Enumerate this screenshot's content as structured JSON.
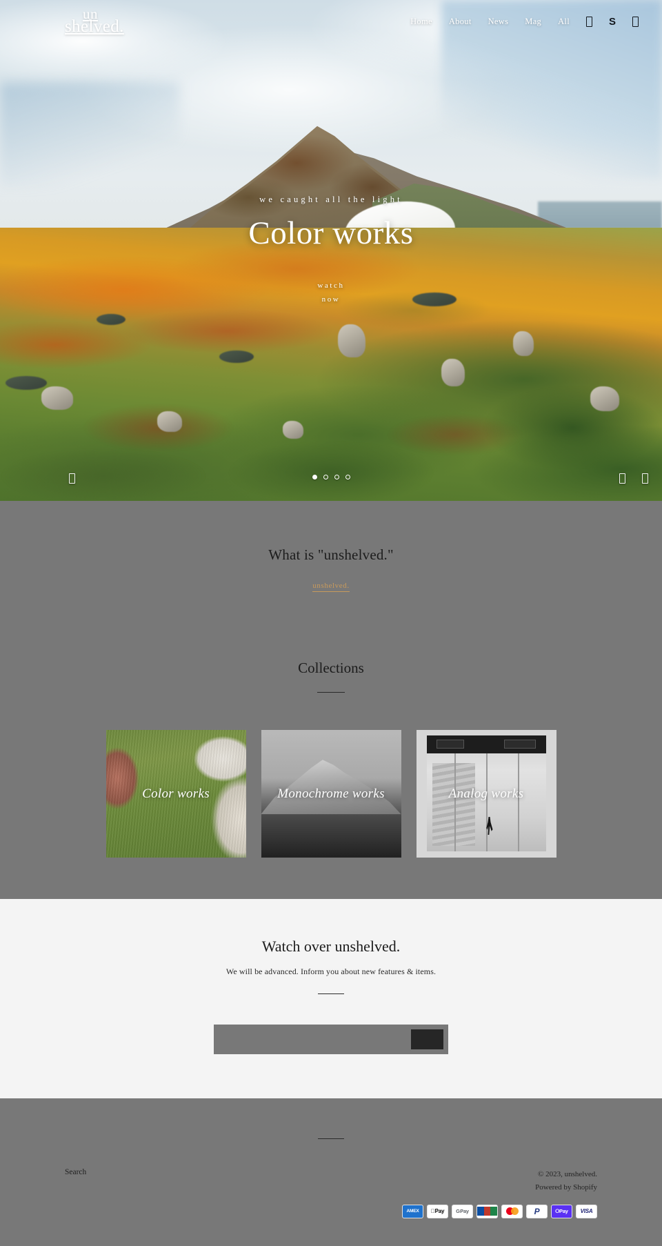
{
  "header": {
    "logo_line1": "un",
    "logo_line2": "shelved.",
    "nav": [
      {
        "label": "Home"
      },
      {
        "label": "About"
      },
      {
        "label": "News"
      },
      {
        "label": "Mag"
      },
      {
        "label": "All"
      }
    ],
    "icons": {
      "search": "search-icon",
      "account": "S",
      "cart": "cart-icon"
    }
  },
  "hero": {
    "kicker": "we caught all the light",
    "title": "Color works",
    "cta_line1": "watch",
    "cta_line2": "now",
    "slides_total": 4,
    "active_slide": 1,
    "play_icon": "play-pause-icon",
    "prev_icon": "arrow-left-icon",
    "next_icon": "arrow-right-icon"
  },
  "about": {
    "title": "What is \"unshelved.\"",
    "link_label": "unshelved.",
    "link_color": "#c89a5c"
  },
  "collections": {
    "title": "Collections",
    "cards": [
      {
        "label": "Color works"
      },
      {
        "label": "Monochrome works"
      },
      {
        "label": "Analog works"
      }
    ]
  },
  "newsletter": {
    "title": "Watch over unshelved.",
    "subtitle": "We will be advanced. Inform you about new features & items.",
    "email_value": "",
    "email_placeholder": "",
    "submit_label": ""
  },
  "footer": {
    "search_label": "Search",
    "copyright": "© 2023, unshelved.",
    "powered_by": "Powered by Shopify",
    "payments": [
      {
        "name": "american-express",
        "label": "AMEX"
      },
      {
        "name": "apple-pay",
        "label": "Pay"
      },
      {
        "name": "google-pay",
        "label": "Pay"
      },
      {
        "name": "jcb",
        "label": "JCB"
      },
      {
        "name": "mastercard",
        "label": ""
      },
      {
        "name": "paypal",
        "label": "P"
      },
      {
        "name": "shop-pay",
        "label": "Pay"
      },
      {
        "name": "visa",
        "label": "VISA"
      }
    ]
  },
  "theme": {
    "gray": "#787878",
    "light": "#f4f4f4",
    "dark": "#262626"
  }
}
